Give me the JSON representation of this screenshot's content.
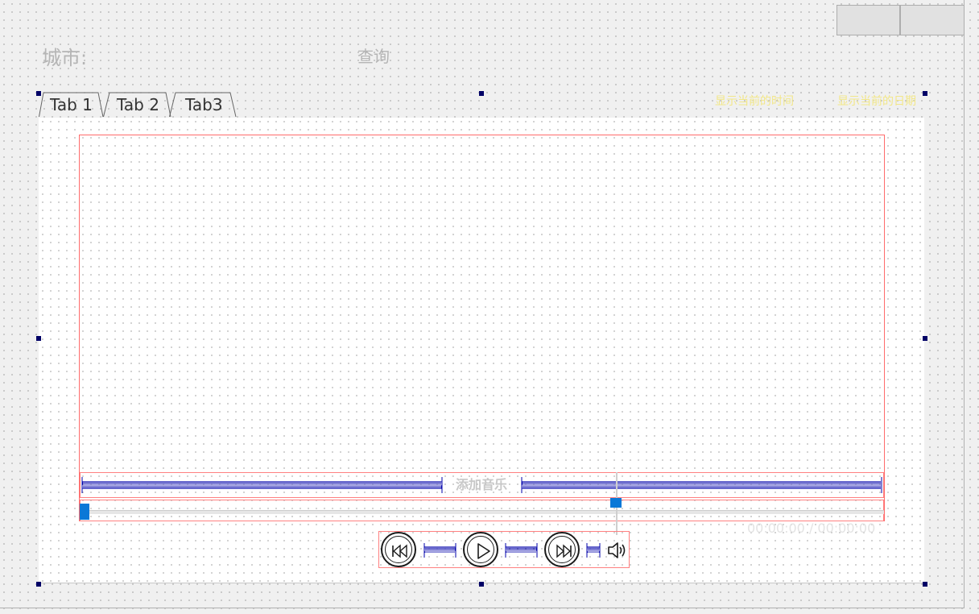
{
  "header": {
    "city_label": "城市:",
    "query_button": "查询",
    "status_left": "显示当前的时间",
    "status_right": "显示当前的日期",
    "top_buttons": [
      "",
      ""
    ]
  },
  "tabs": [
    {
      "label": "Tab 1"
    },
    {
      "label": "Tab 2"
    },
    {
      "label": "Tab3"
    }
  ],
  "player": {
    "add_music_label": "添加音乐",
    "time_display": "00:00:00 / 00:00:00",
    "progress": 0,
    "controls": [
      {
        "name": "previous-track",
        "icon": "skip-back-icon"
      },
      {
        "name": "play",
        "icon": "play-icon"
      },
      {
        "name": "next-track",
        "icon": "skip-forward-icon"
      },
      {
        "name": "volume",
        "icon": "speaker-icon"
      }
    ]
  },
  "colors": {
    "accent": "#0a78d7",
    "layout_border": "#ff6b6b",
    "status_text": "#f2e78a",
    "selection_handle": "#000066"
  }
}
